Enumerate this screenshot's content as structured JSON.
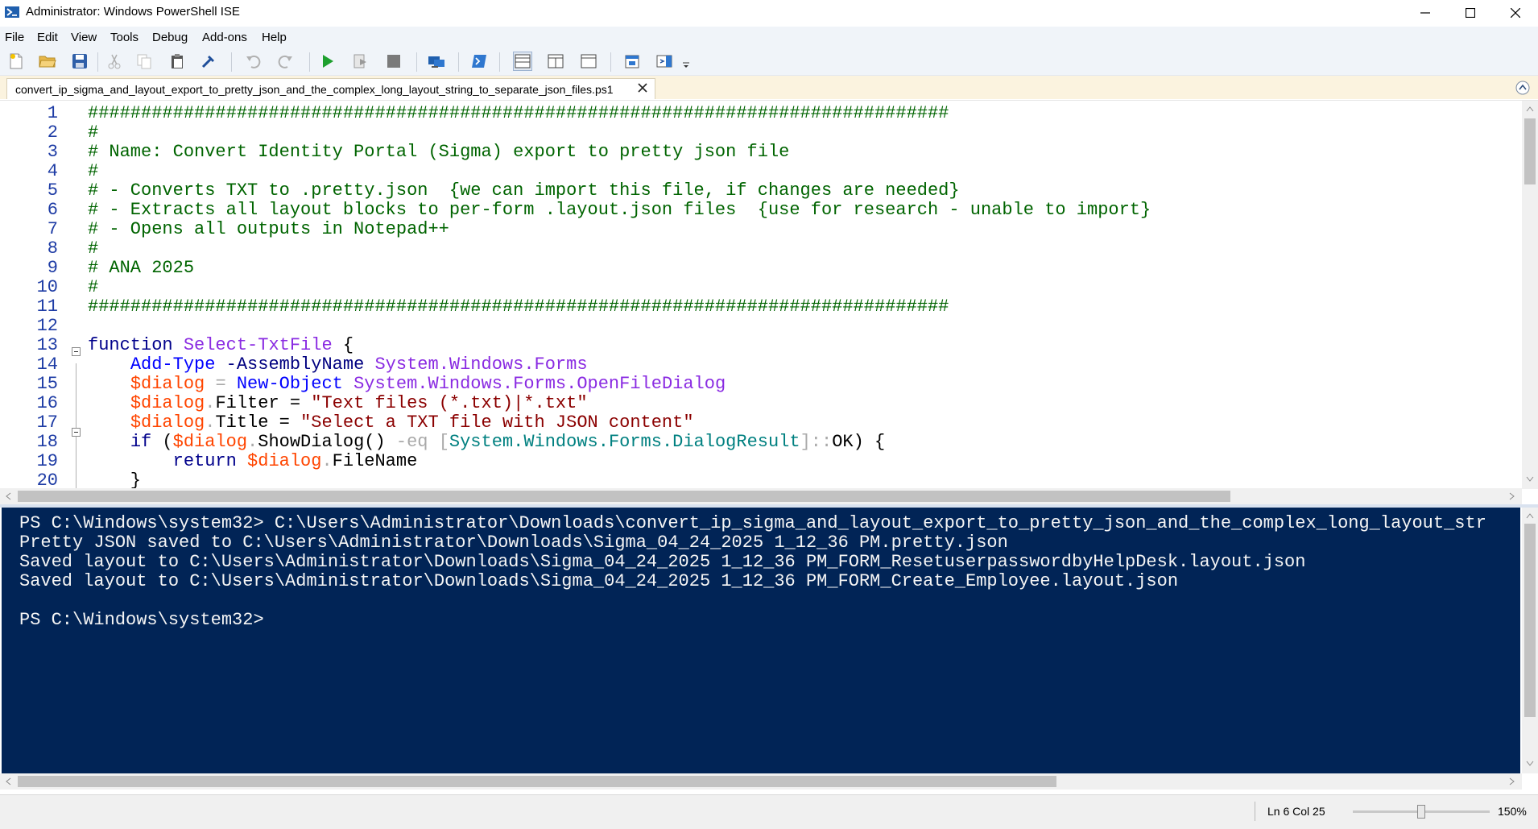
{
  "window": {
    "title": "Administrator: Windows PowerShell ISE",
    "colors": {
      "titlebar": "#ffffff",
      "menubar": "#f0f4f9",
      "tabstrip": "#fbf3df",
      "console_bg": "#012456"
    }
  },
  "menu": {
    "items": [
      "File",
      "Edit",
      "View",
      "Tools",
      "Debug",
      "Add-ons",
      "Help"
    ]
  },
  "toolbar": {
    "buttons": [
      "new-script-icon",
      "open-script-icon",
      "save-script-icon",
      "cut-icon",
      "copy-icon",
      "paste-icon",
      "clear-console-icon",
      "undo-icon",
      "redo-icon",
      "run-script-icon",
      "run-selection-icon",
      "stop-icon",
      "remote-powershell-icon",
      "powershell-console-icon",
      "show-script-top-icon",
      "show-script-right-icon",
      "show-script-max-icon",
      "show-command-window-icon",
      "show-command-addon-icon",
      "customize-toolbar-icon"
    ]
  },
  "tab": {
    "label": "convert_ip_sigma_and_layout_export_to_pretty_json_and_the_complex_long_layout_string_to_separate_json_files.ps1"
  },
  "editor": {
    "lines": [
      {
        "n": "1",
        "segments": [
          {
            "c": "comment",
            "t": "#################################################################################"
          }
        ]
      },
      {
        "n": "2",
        "segments": [
          {
            "c": "comment",
            "t": "#"
          }
        ]
      },
      {
        "n": "3",
        "segments": [
          {
            "c": "comment",
            "t": "# Name: Convert Identity Portal (Sigma) export to pretty json file"
          }
        ]
      },
      {
        "n": "4",
        "segments": [
          {
            "c": "comment",
            "t": "#"
          }
        ]
      },
      {
        "n": "5",
        "segments": [
          {
            "c": "comment",
            "t": "# - Converts TXT to .pretty.json  {we can import this file, if changes are needed}"
          }
        ]
      },
      {
        "n": "6",
        "segments": [
          {
            "c": "comment",
            "t": "# - Extracts all layout blocks to per-form .layout.json files  {use for research - unable to import}"
          }
        ]
      },
      {
        "n": "7",
        "segments": [
          {
            "c": "comment",
            "t": "# - Opens all outputs in Notepad++"
          }
        ]
      },
      {
        "n": "8",
        "segments": [
          {
            "c": "comment",
            "t": "#"
          }
        ]
      },
      {
        "n": "9",
        "segments": [
          {
            "c": "comment",
            "t": "# ANA 2025"
          }
        ]
      },
      {
        "n": "10",
        "segments": [
          {
            "c": "comment",
            "t": "#"
          }
        ]
      },
      {
        "n": "11",
        "segments": [
          {
            "c": "comment",
            "t": "#################################################################################"
          }
        ]
      },
      {
        "n": "12",
        "segments": []
      },
      {
        "n": "13",
        "segments": [
          {
            "c": "kw",
            "t": "function"
          },
          {
            "c": "",
            "t": " "
          },
          {
            "c": "fn",
            "t": "Select-TxtFile"
          },
          {
            "c": "",
            "t": " {"
          }
        ]
      },
      {
        "n": "14",
        "segments": [
          {
            "c": "",
            "t": "    "
          },
          {
            "c": "cmd",
            "t": "Add-Type"
          },
          {
            "c": "",
            "t": " "
          },
          {
            "c": "param",
            "t": "-AssemblyName"
          },
          {
            "c": "",
            "t": " "
          },
          {
            "c": "fn",
            "t": "System.Windows.Forms"
          }
        ]
      },
      {
        "n": "15",
        "segments": [
          {
            "c": "",
            "t": "    "
          },
          {
            "c": "var",
            "t": "$dialog"
          },
          {
            "c": "",
            "t": " "
          },
          {
            "c": "op",
            "t": "="
          },
          {
            "c": "",
            "t": " "
          },
          {
            "c": "cmd",
            "t": "New-Object"
          },
          {
            "c": "",
            "t": " "
          },
          {
            "c": "fn",
            "t": "System.Windows.Forms.OpenFileDialog"
          }
        ]
      },
      {
        "n": "16",
        "segments": [
          {
            "c": "",
            "t": "    "
          },
          {
            "c": "var",
            "t": "$dialog"
          },
          {
            "c": "op",
            "t": "."
          },
          {
            "c": "",
            "t": "Filter = "
          },
          {
            "c": "str",
            "t": "\"Text files (*.txt)|*.txt\""
          }
        ]
      },
      {
        "n": "17",
        "segments": [
          {
            "c": "",
            "t": "    "
          },
          {
            "c": "var",
            "t": "$dialog"
          },
          {
            "c": "op",
            "t": "."
          },
          {
            "c": "",
            "t": "Title = "
          },
          {
            "c": "str",
            "t": "\"Select a TXT file with JSON content\""
          }
        ]
      },
      {
        "n": "18",
        "segments": [
          {
            "c": "",
            "t": "    "
          },
          {
            "c": "kw",
            "t": "if"
          },
          {
            "c": "",
            "t": " ("
          },
          {
            "c": "var",
            "t": "$dialog"
          },
          {
            "c": "op",
            "t": "."
          },
          {
            "c": "",
            "t": "ShowDialog() "
          },
          {
            "c": "op",
            "t": "-eq"
          },
          {
            "c": "",
            "t": " "
          },
          {
            "c": "op",
            "t": "["
          },
          {
            "c": "type",
            "t": "System.Windows.Forms.DialogResult"
          },
          {
            "c": "op",
            "t": "]::"
          },
          {
            "c": "",
            "t": "OK) {"
          }
        ]
      },
      {
        "n": "19",
        "segments": [
          {
            "c": "",
            "t": "        "
          },
          {
            "c": "kw",
            "t": "return"
          },
          {
            "c": "",
            "t": " "
          },
          {
            "c": "var",
            "t": "$dialog"
          },
          {
            "c": "op",
            "t": "."
          },
          {
            "c": "",
            "t": "FileName"
          }
        ]
      },
      {
        "n": "20",
        "segments": [
          {
            "c": "",
            "t": "    }"
          }
        ]
      }
    ]
  },
  "console": {
    "lines": [
      "PS C:\\Windows\\system32> C:\\Users\\Administrator\\Downloads\\convert_ip_sigma_and_layout_export_to_pretty_json_and_the_complex_long_layout_str",
      "Pretty JSON saved to C:\\Users\\Administrator\\Downloads\\Sigma_04_24_2025 1_12_36 PM.pretty.json",
      "Saved layout to C:\\Users\\Administrator\\Downloads\\Sigma_04_24_2025 1_12_36 PM_FORM_ResetuserpasswordbyHelpDesk.layout.json",
      "Saved layout to C:\\Users\\Administrator\\Downloads\\Sigma_04_24_2025 1_12_36 PM_FORM_Create_Employee.layout.json",
      "",
      "PS C:\\Windows\\system32>"
    ]
  },
  "status": {
    "position": "Ln 6  Col 25",
    "zoom": "150%",
    "zoom_level": 0.5
  }
}
